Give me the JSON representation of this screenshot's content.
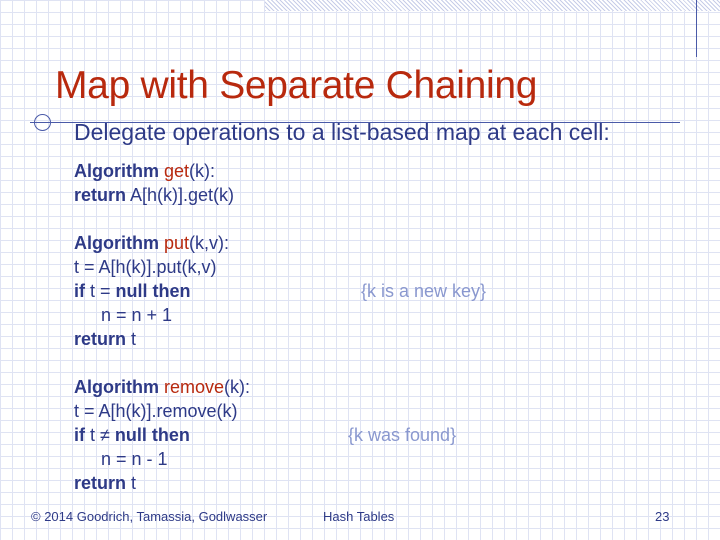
{
  "slide": {
    "title": "Map with Separate Chaining",
    "subtitle": "Delegate operations to a list-based map at each cell:"
  },
  "code": {
    "get": {
      "algorithm": "Algorithm",
      "name": "get",
      "params": "(k):",
      "return_kw": "return",
      "return_expr": "A[h(k)].get(k)"
    },
    "put": {
      "algorithm": "Algorithm",
      "name": "put",
      "params": "(k,v):",
      "line1": "t = A[h(k)].put(k,v)",
      "if_kw": "if",
      "cond": "t =",
      "null_then": "null then",
      "comment": "{k is a new key}",
      "inc": "n = n + 1",
      "return_kw": "return",
      "return_expr": "t"
    },
    "remove": {
      "algorithm": "Algorithm",
      "name": "remove",
      "params": "(k):",
      "line1": "t = A[h(k)].remove(k)",
      "if_kw": "if",
      "cond": "t ≠",
      "null_then": "null then",
      "comment": "{k was found}",
      "dec": "n = n - 1",
      "return_kw": "return",
      "return_expr": "t"
    }
  },
  "footer": {
    "copyright": "© 2014 Goodrich, Tamassia, Godlwasser",
    "topic": "Hash Tables",
    "page": "23"
  }
}
